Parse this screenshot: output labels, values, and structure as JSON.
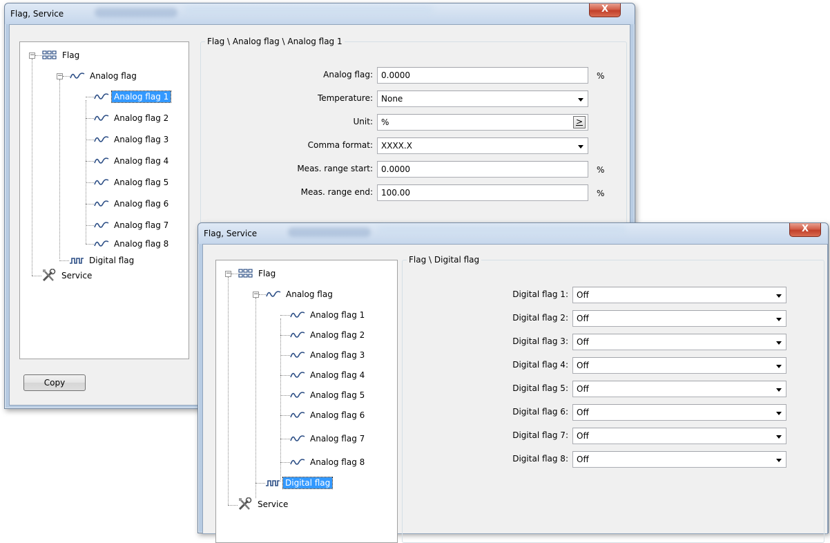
{
  "colors": {
    "selection": "#3399ff",
    "close_button": "#c2402a",
    "title_bar": "#c6d7ec"
  },
  "window1": {
    "title": "Flag, Service",
    "close_label": "X",
    "breadcrumb": "Flag \\ Analog flag \\ Analog flag 1",
    "copy_label": "Copy",
    "tree": {
      "root": "Flag",
      "analog": "Analog flag",
      "analog_items": [
        "Analog flag 1",
        "Analog flag 2",
        "Analog flag 3",
        "Analog flag 4",
        "Analog flag 5",
        "Analog flag 6",
        "Analog flag 7",
        "Analog flag 8"
      ],
      "digital": "Digital flag",
      "service": "Service",
      "selected": "Analog flag 1"
    },
    "form": {
      "analog_flag": {
        "label": "Analog flag:",
        "value": "0.0000",
        "unit": "%"
      },
      "temperature": {
        "label": "Temperature:",
        "value": "None"
      },
      "unit": {
        "label": "Unit:",
        "value": "%",
        "button": ">"
      },
      "comma_format": {
        "label": "Comma format:",
        "value": "XXXX.X"
      },
      "range_start": {
        "label": "Meas. range start:",
        "value": "0.0000",
        "unit": "%"
      },
      "range_end": {
        "label": "Meas. range end:",
        "value": "100.00",
        "unit": "%"
      }
    }
  },
  "window2": {
    "title": "Flag, Service",
    "close_label": "X",
    "breadcrumb": "Flag \\ Digital flag",
    "tree": {
      "root": "Flag",
      "analog": "Analog flag",
      "analog_items": [
        "Analog flag 1",
        "Analog flag 2",
        "Analog flag 3",
        "Analog flag 4",
        "Analog flag 5",
        "Analog flag 6",
        "Analog flag 7",
        "Analog flag 8"
      ],
      "digital": "Digital flag",
      "service": "Service",
      "selected": "Digital flag"
    },
    "digital_flags": [
      {
        "label": "Digital flag 1:",
        "value": "Off"
      },
      {
        "label": "Digital flag 2:",
        "value": "Off"
      },
      {
        "label": "Digital flag 3:",
        "value": "Off"
      },
      {
        "label": "Digital flag 4:",
        "value": "Off"
      },
      {
        "label": "Digital flag 5:",
        "value": "Off"
      },
      {
        "label": "Digital flag 6:",
        "value": "Off"
      },
      {
        "label": "Digital flag 7:",
        "value": "Off"
      },
      {
        "label": "Digital flag 8:",
        "value": "Off"
      }
    ]
  }
}
